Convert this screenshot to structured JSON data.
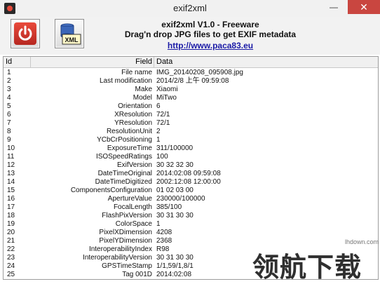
{
  "window": {
    "title": "exif2xml"
  },
  "toolbar": {
    "line1": "exif2xml V1.0 - Freeware",
    "line2": "Drag'n drop JPG files to get EXIF metadata",
    "link": "http://www.paca83.eu",
    "xml_label": "XML"
  },
  "table": {
    "headers": {
      "id": "Id",
      "field": "Field",
      "data": "Data"
    },
    "rows": [
      {
        "id": "1",
        "field": "File name",
        "data": "IMG_20140208_095908.jpg"
      },
      {
        "id": "2",
        "field": "Last modification",
        "data": "2014/2/8 上午 09:59:08"
      },
      {
        "id": "3",
        "field": "Make",
        "data": "Xiaomi"
      },
      {
        "id": "4",
        "field": "Model",
        "data": "MiTwo"
      },
      {
        "id": "5",
        "field": "Orientation",
        "data": "6"
      },
      {
        "id": "6",
        "field": "XResolution",
        "data": "72/1"
      },
      {
        "id": "7",
        "field": "YResolution",
        "data": "72/1"
      },
      {
        "id": "8",
        "field": "ResolutionUnit",
        "data": "2"
      },
      {
        "id": "9",
        "field": "YCbCrPositioning",
        "data": "1"
      },
      {
        "id": "10",
        "field": "ExposureTime",
        "data": "311/100000"
      },
      {
        "id": "11",
        "field": "ISOSpeedRatings",
        "data": "100"
      },
      {
        "id": "12",
        "field": "ExifVersion",
        "data": "30 32 32 30"
      },
      {
        "id": "13",
        "field": "DateTimeOriginal",
        "data": "2014:02:08 09:59:08"
      },
      {
        "id": "14",
        "field": "DateTimeDigitized",
        "data": "2002:12:08 12:00:00"
      },
      {
        "id": "15",
        "field": "ComponentsConfiguration",
        "data": "01 02 03 00"
      },
      {
        "id": "16",
        "field": "ApertureValue",
        "data": "230000/100000"
      },
      {
        "id": "17",
        "field": "FocalLength",
        "data": "385/100"
      },
      {
        "id": "18",
        "field": "FlashPixVersion",
        "data": "30 31 30 30"
      },
      {
        "id": "19",
        "field": "ColorSpace",
        "data": "1"
      },
      {
        "id": "20",
        "field": "PixelXDimension",
        "data": "4208"
      },
      {
        "id": "21",
        "field": "PixelYDimension",
        "data": "2368"
      },
      {
        "id": "22",
        "field": "InteroperabilityIndex",
        "data": "R98"
      },
      {
        "id": "23",
        "field": "InteroperabilityVersion",
        "data": "30 31 30 30"
      },
      {
        "id": "24",
        "field": "GPSTimeStamp",
        "data": "1/1,59/1,8/1"
      },
      {
        "id": "25",
        "field": "Tag 001D",
        "data": "2014:02:08"
      }
    ]
  },
  "watermark": {
    "site": "lhdown.com",
    "text": "领航下载"
  },
  "colors": {
    "power_red": "#d63b2f",
    "link_blue": "#1a1aa6",
    "close_red": "#c94640"
  }
}
